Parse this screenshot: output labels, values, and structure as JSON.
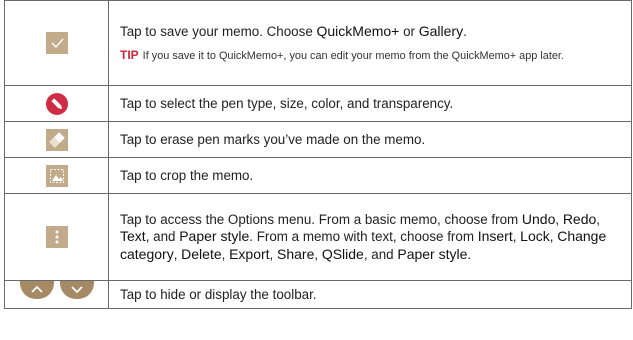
{
  "rows": [
    {
      "icon": "checkmark-icon",
      "segments": [
        "Tap to save your memo. Choose ",
        "QuickMemo+",
        " or ",
        "Gallery",
        "."
      ],
      "tip_label": "TIP",
      "tip_text": "If you save it to QuickMemo+, you can edit your memo from the QuickMemo+ app later."
    },
    {
      "icon": "pen-icon",
      "text": "Tap to select the pen type, size, color, and transparency."
    },
    {
      "icon": "eraser-icon",
      "text": "Tap to erase pen marks you’ve made on the memo."
    },
    {
      "icon": "crop-icon",
      "text": "Tap to crop the memo."
    },
    {
      "icon": "more-options-icon",
      "segments": [
        "Tap to access the Options menu. From a basic memo, choose from ",
        "Undo",
        ", ",
        "Redo",
        ", ",
        "Text",
        ", and ",
        "Paper style",
        ". From a memo with text, choose from ",
        "Insert",
        ", ",
        "Lock",
        ", ",
        "Change category",
        ", ",
        "Delete",
        ", ",
        "Export",
        ", ",
        "Share",
        ", ",
        "QSlide",
        ", and ",
        "Paper style",
        "."
      ]
    },
    {
      "icon": "toolbar-toggle-icons",
      "text": "Tap to hide or display the toolbar."
    }
  ],
  "colors": {
    "icon_tan": "#c2ab8b",
    "pen_red": "#cf2d46",
    "tab_brown": "#a68a66",
    "tip_red": "#d2233b"
  }
}
